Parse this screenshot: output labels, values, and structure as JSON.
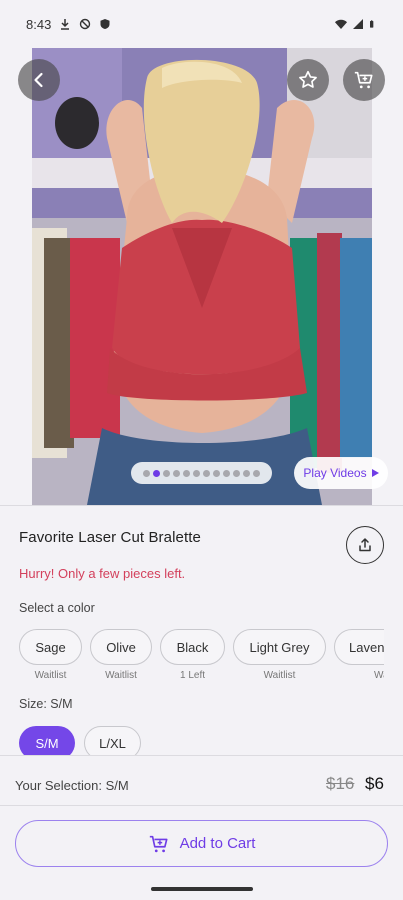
{
  "status_bar": {
    "time": "8:43",
    "left_icons": [
      "download-icon",
      "do-not-disturb-icon",
      "shield-icon"
    ],
    "right_icons": [
      "wifi-icon",
      "signal-icon",
      "battery-icon"
    ]
  },
  "hero": {
    "image_count": 12,
    "active_image_index": 1,
    "play_videos_label": "Play Videos"
  },
  "product": {
    "title": "Favorite Laser Cut Bralette",
    "urgency": "Hurry! Only a few pieces left.",
    "color_label": "Select a color",
    "colors": [
      {
        "name": "Sage",
        "status": "Waitlist"
      },
      {
        "name": "Olive",
        "status": "Waitlist"
      },
      {
        "name": "Black",
        "status": "1 Left"
      },
      {
        "name": "Light Grey",
        "status": "Waitlist"
      },
      {
        "name": "Lavender",
        "status": "Waitlist"
      }
    ],
    "size_label": "Size: S/M",
    "sizes": [
      {
        "name": "S/M",
        "selected": true
      },
      {
        "name": "L/XL",
        "selected": false
      }
    ]
  },
  "bottom": {
    "selection": "Your Selection: S/M",
    "old_price": "$16",
    "new_price": "$6",
    "add_to_cart": "Add to Cart"
  },
  "colors": {
    "accent": "#6f3ce6",
    "urgency": "#d3405c"
  }
}
